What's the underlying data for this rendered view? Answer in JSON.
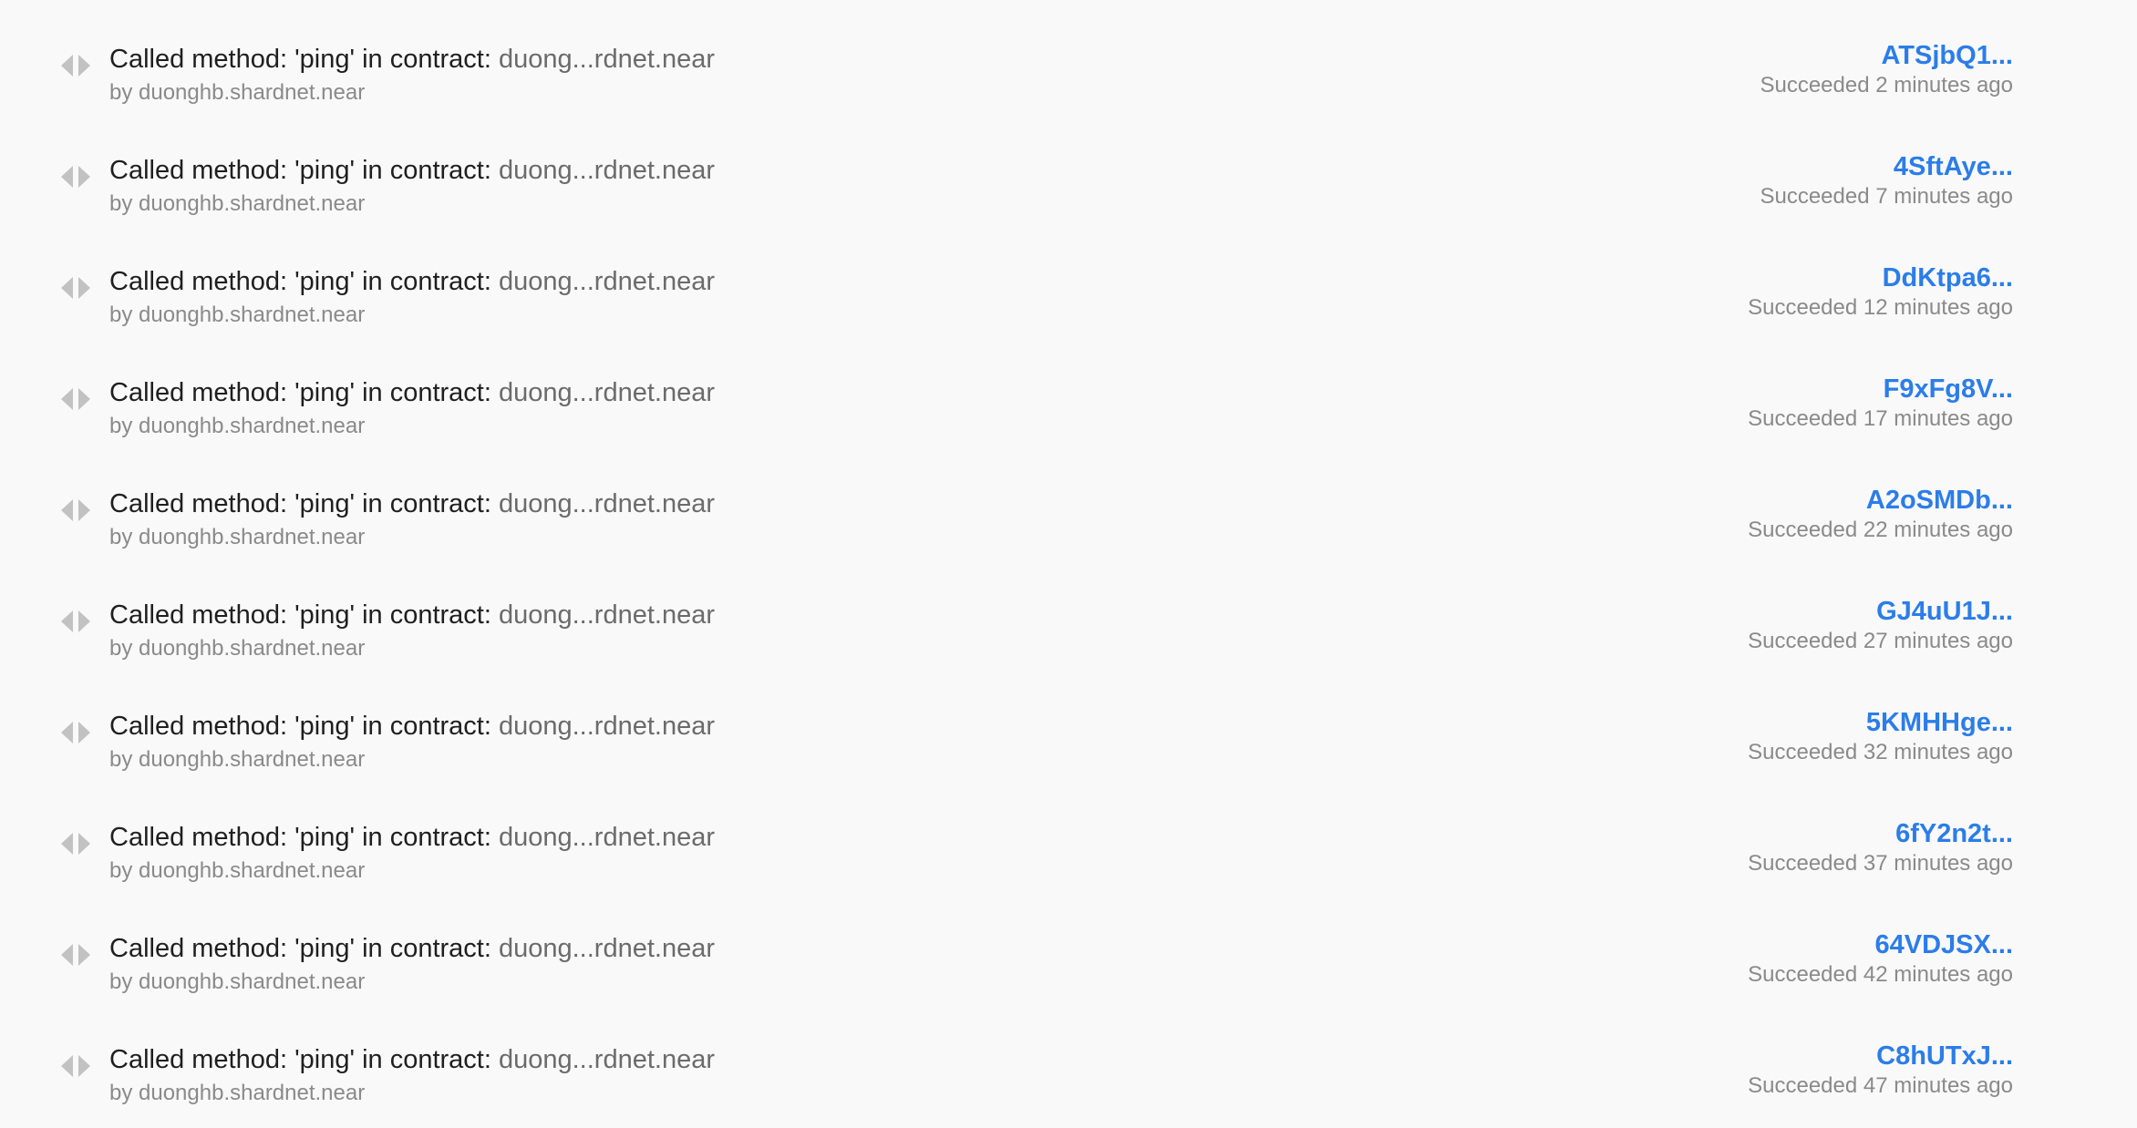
{
  "transactions": [
    {
      "title": "Called method: 'ping' in contract: ",
      "contract": "duong...rdnet.near",
      "signer": "by duonghb.shardnet.near",
      "hash": "ATSjbQ1...",
      "status": "Succeeded",
      "time": "2 minutes ago"
    },
    {
      "title": "Called method: 'ping' in contract: ",
      "contract": "duong...rdnet.near",
      "signer": "by duonghb.shardnet.near",
      "hash": "4SftAye...",
      "status": "Succeeded",
      "time": "7 minutes ago"
    },
    {
      "title": "Called method: 'ping' in contract: ",
      "contract": "duong...rdnet.near",
      "signer": "by duonghb.shardnet.near",
      "hash": "DdKtpa6...",
      "status": "Succeeded",
      "time": "12 minutes ago"
    },
    {
      "title": "Called method: 'ping' in contract: ",
      "contract": "duong...rdnet.near",
      "signer": "by duonghb.shardnet.near",
      "hash": "F9xFg8V...",
      "status": "Succeeded",
      "time": "17 minutes ago"
    },
    {
      "title": "Called method: 'ping' in contract: ",
      "contract": "duong...rdnet.near",
      "signer": "by duonghb.shardnet.near",
      "hash": "A2oSMDb...",
      "status": "Succeeded",
      "time": "22 minutes ago"
    },
    {
      "title": "Called method: 'ping' in contract: ",
      "contract": "duong...rdnet.near",
      "signer": "by duonghb.shardnet.near",
      "hash": "GJ4uU1J...",
      "status": "Succeeded",
      "time": "27 minutes ago"
    },
    {
      "title": "Called method: 'ping' in contract: ",
      "contract": "duong...rdnet.near",
      "signer": "by duonghb.shardnet.near",
      "hash": "5KMHHge...",
      "status": "Succeeded",
      "time": "32 minutes ago"
    },
    {
      "title": "Called method: 'ping' in contract: ",
      "contract": "duong...rdnet.near",
      "signer": "by duonghb.shardnet.near",
      "hash": "6fY2n2t...",
      "status": "Succeeded",
      "time": "37 minutes ago"
    },
    {
      "title": "Called method: 'ping' in contract: ",
      "contract": "duong...rdnet.near",
      "signer": "by duonghb.shardnet.near",
      "hash": "64VDJSX...",
      "status": "Succeeded",
      "time": "42 minutes ago"
    },
    {
      "title": "Called method: 'ping' in contract: ",
      "contract": "duong...rdnet.near",
      "signer": "by duonghb.shardnet.near",
      "hash": "C8hUTxJ...",
      "status": "Succeeded",
      "time": "47 minutes ago"
    }
  ],
  "icons": {
    "row_icon": "code-brackets-icon"
  },
  "colors": {
    "hash_link": "#2b7de9",
    "title_text": "#1f1f1f",
    "muted_text": "#8a8a8a",
    "contract_text": "#6b6b6b",
    "background": "#f9f9f9"
  }
}
